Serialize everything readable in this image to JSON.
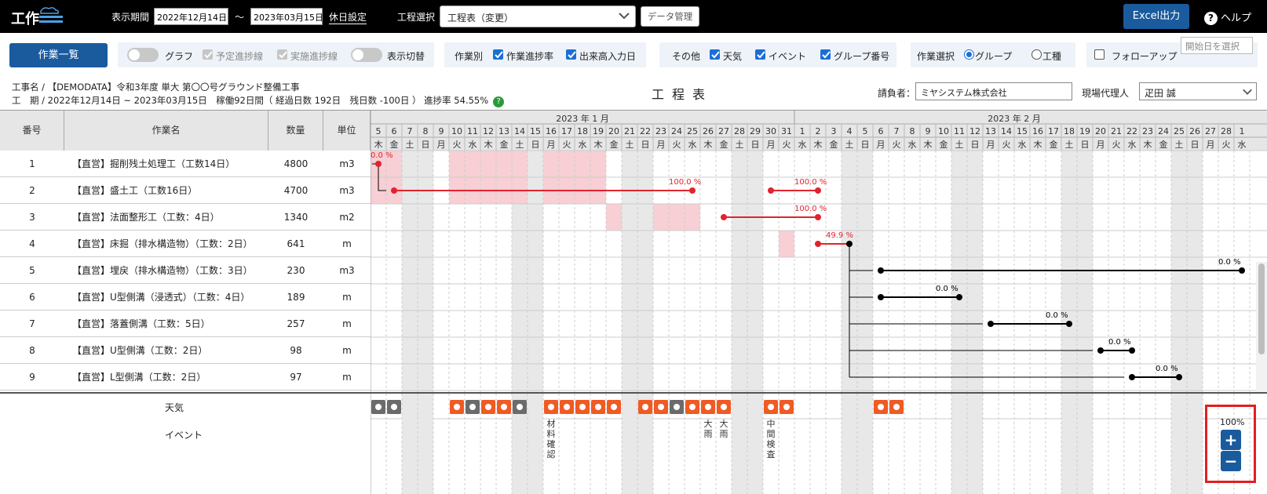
{
  "topbar": {
    "logo_text": "工作",
    "period_label": "表示期間",
    "start_date": "2022年12月14日",
    "tilde": "～",
    "end_date": "2023年03月15日",
    "holiday_setting": "休日設定",
    "process_label": "工程選択",
    "process_value": "工程表（変更）",
    "data_mgmt": "データ管理",
    "excel_btn": "Excel出力",
    "help": "ヘルプ"
  },
  "toolbar": {
    "work_list_btn": "作業一覧",
    "graph": "グラフ",
    "planned_line": "予定進捗線",
    "actual_line": "実施進捗線",
    "display_toggle": "表示切替",
    "per_work": "作業別",
    "work_progress": "作業進捗率",
    "output_date": "出来高入力日",
    "other": "その他",
    "weather": "天気",
    "event": "イベント",
    "group_no": "グループ番号",
    "work_select": "作業選択",
    "group": "グループ",
    "work_type": "工種",
    "follow_up": "フォローアップ",
    "start_date_placeholder": "開始日を選択"
  },
  "info": {
    "project_line": "工事名 / 【DEMODATA】令和3年度 単大 第〇〇号グラウンド整備工事",
    "period_line": "工　期 / 2022年12月14日 ~ 2023年03月15日　稼働92日間（ 経過日数 192日　残日数 -100日 ）  進捗率 54.55%",
    "title": "工程表",
    "contractor_label": "請負者：",
    "contractor": "ミヤシステム株式会社",
    "agent_label": "現場代理人",
    "agent": "疋田 誠"
  },
  "table": {
    "headers": [
      "番号",
      "作業名",
      "数量",
      "単位"
    ],
    "rows": [
      {
        "no": "1",
        "name": "【直営】掘削残土処理工（工数14日）",
        "qty": "4800",
        "unit": "m3"
      },
      {
        "no": "2",
        "name": "【直営】盛土工（工数16日）",
        "qty": "4700",
        "unit": "m3"
      },
      {
        "no": "3",
        "name": "【直営】法面整形工（工数：4日）",
        "qty": "1340",
        "unit": "m2"
      },
      {
        "no": "4",
        "name": "【直営】床掘（排水構造物）（工数：2日）",
        "qty": "641",
        "unit": "m"
      },
      {
        "no": "5",
        "name": "【直営】埋戻（排水構造物）（工数：3日）",
        "qty": "230",
        "unit": "m3"
      },
      {
        "no": "6",
        "name": "【直営】U型側溝（浸透式）（工数：4日）",
        "qty": "189",
        "unit": "m"
      },
      {
        "no": "7",
        "name": "【直営】落蓋側溝（工数：5日）",
        "qty": "257",
        "unit": "m"
      },
      {
        "no": "8",
        "name": "【直営】U型側溝（工数：2日）",
        "qty": "98",
        "unit": "m"
      },
      {
        "no": "9",
        "name": "【直営】L型側溝（工数：2日）",
        "qty": "97",
        "unit": "m"
      }
    ]
  },
  "gantt": {
    "months": [
      {
        "label": "2023 年 1 月",
        "start": 0,
        "len": 27
      },
      {
        "label": "2023 年 2 月",
        "start": 27,
        "len": 28
      }
    ],
    "days": [
      "5",
      "6",
      "7",
      "8",
      "9",
      "10",
      "11",
      "12",
      "13",
      "14",
      "15",
      "16",
      "17",
      "18",
      "19",
      "20",
      "21",
      "22",
      "23",
      "24",
      "25",
      "26",
      "27",
      "28",
      "29",
      "30",
      "31",
      "1",
      "2",
      "3",
      "4",
      "5",
      "6",
      "7",
      "8",
      "9",
      "10",
      "11",
      "12",
      "13",
      "14",
      "15",
      "16",
      "17",
      "18",
      "19",
      "20",
      "21",
      "22",
      "23",
      "24",
      "25",
      "26",
      "27",
      "28",
      "1"
    ],
    "weekdays": [
      "木",
      "金",
      "土",
      "日",
      "月",
      "火",
      "水",
      "木",
      "金",
      "土",
      "日",
      "月",
      "火",
      "水",
      "木",
      "金",
      "土",
      "日",
      "月",
      "火",
      "水",
      "木",
      "金",
      "土",
      "日",
      "月",
      "火",
      "水",
      "木",
      "金",
      "土",
      "日",
      "月",
      "火",
      "水",
      "木",
      "金",
      "土",
      "日",
      "月",
      "火",
      "水",
      "木",
      "金",
      "土",
      "日",
      "月",
      "火",
      "水",
      "木",
      "金",
      "土",
      "日",
      "月",
      "火",
      "水"
    ],
    "weekend_cols": [
      2,
      3,
      9,
      10,
      16,
      17,
      23,
      24,
      30,
      31,
      37,
      38,
      44,
      45,
      51,
      52
    ],
    "planned": [
      {
        "row": 0,
        "cols": [
          0,
          1,
          5,
          6,
          7,
          8,
          9,
          11,
          12,
          13,
          14
        ]
      },
      {
        "row": 1,
        "cols": [
          0,
          1,
          5,
          6,
          7,
          8,
          9,
          11,
          12,
          13,
          14
        ]
      },
      {
        "row": 2,
        "cols": [
          15,
          18,
          19,
          20
        ]
      },
      {
        "row": 3,
        "cols": [
          26
        ]
      }
    ],
    "bars": [
      {
        "row": 0,
        "from": 0,
        "to": 0,
        "label": "0.0 %",
        "red": true
      },
      {
        "row": 1,
        "from": 1,
        "to": 20,
        "label": "100.0 %",
        "red": true
      },
      {
        "row": 1,
        "from": 25,
        "to": 28,
        "label": "100.0 %",
        "red": true
      },
      {
        "row": 2,
        "from": 22,
        "to": 28,
        "label": "100.0 %",
        "red": true
      },
      {
        "row": 3,
        "from": 28,
        "to": 30,
        "label": "49.9 %",
        "red": true
      },
      {
        "row": 4,
        "from": 32,
        "to": 55,
        "label": "0.0 %",
        "red": false
      },
      {
        "row": 5,
        "from": 32,
        "to": 37,
        "label": "0.0 %",
        "red": false
      },
      {
        "row": 6,
        "from": 39,
        "to": 44,
        "label": "0.0 %",
        "red": false
      },
      {
        "row": 7,
        "from": 46,
        "to": 48,
        "label": "0.0 %",
        "red": false
      },
      {
        "row": 8,
        "from": 48,
        "to": 51,
        "label": "0.0 %",
        "red": false
      }
    ]
  },
  "bottom": {
    "weather_label": "天気",
    "event_label": "イベント",
    "weather_cols": [
      0,
      1,
      5,
      6,
      7,
      8,
      9,
      11,
      12,
      13,
      14,
      15,
      17,
      18,
      19,
      20,
      21,
      22,
      25,
      26,
      32,
      33
    ],
    "events": [
      {
        "col": 11,
        "text": "材料確認"
      },
      {
        "col": 21,
        "text": "大雨"
      },
      {
        "col": 22,
        "text": "大雨"
      },
      {
        "col": 25,
        "text": "中間検査"
      }
    ],
    "zoom": "100%"
  }
}
